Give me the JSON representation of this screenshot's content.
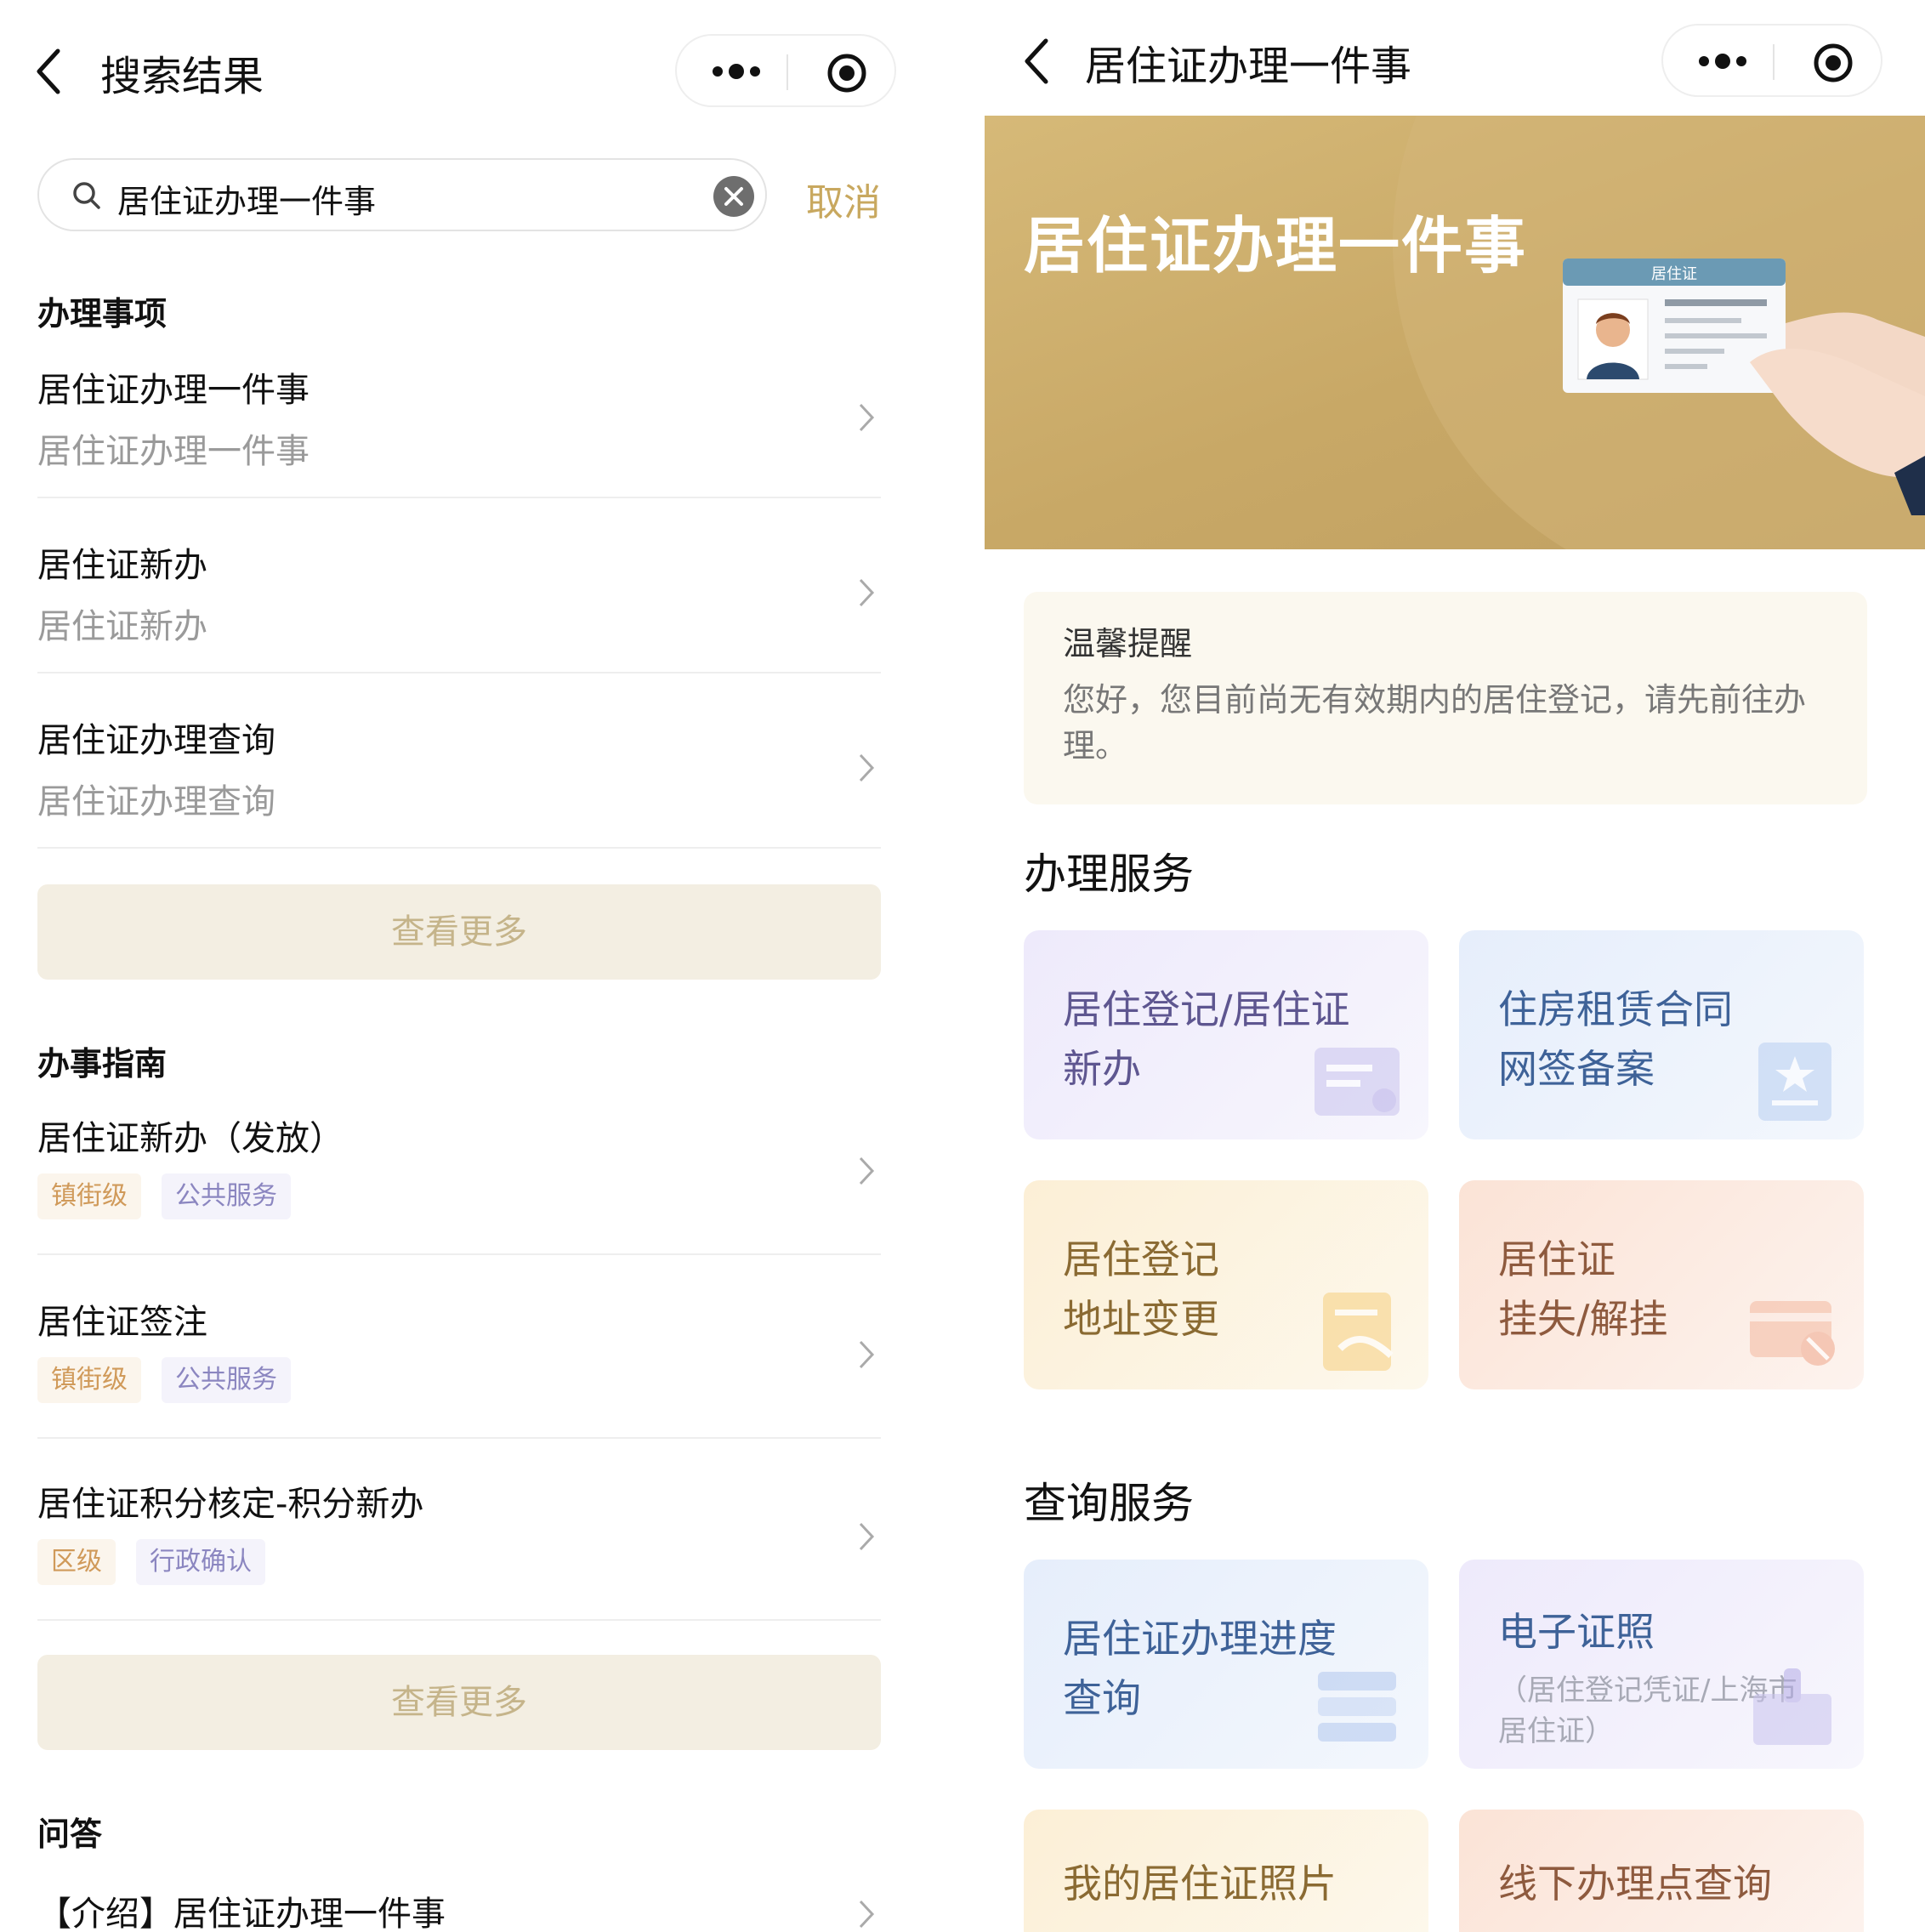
{
  "left": {
    "nav": {
      "title": "搜索结果"
    },
    "search": {
      "value": "居住证办理一件事",
      "cancel_label": "取消"
    },
    "section_items": {
      "title": "办理事项",
      "items": [
        {
          "title": "居住证办理一件事",
          "subtitle": "居住证办理一件事"
        },
        {
          "title": "居住证新办",
          "subtitle": "居住证新办"
        },
        {
          "title": "居住证办理查询",
          "subtitle": "居住证办理查询"
        }
      ],
      "more_label": "查看更多"
    },
    "section_guide": {
      "title": "办事指南",
      "items": [
        {
          "title": "居住证新办（发放）",
          "tags": [
            "镇街级",
            "公共服务"
          ]
        },
        {
          "title": "居住证签注",
          "tags": [
            "镇街级",
            "公共服务"
          ]
        },
        {
          "title": "居住证积分核定-积分新办",
          "tags": [
            "区级",
            "行政确认"
          ]
        }
      ],
      "more_label": "查看更多"
    },
    "section_qa": {
      "title": "问答",
      "items": [
        {
          "title": "【介绍】居住证办理一件事"
        }
      ]
    }
  },
  "right": {
    "nav": {
      "title": "居住证办理一件事"
    },
    "banner": {
      "title": "居住证办理一件事",
      "card_label": "居住证"
    },
    "tip": {
      "title": "温馨提醒",
      "body": "您好，您目前尚无有效期内的居住登记，请先前往办理。"
    },
    "service": {
      "title": "办理服务",
      "cards": [
        {
          "line1": "居住登记/居住证",
          "line2": "新办",
          "icon": "id-card-icon"
        },
        {
          "line1": "住房租赁合同",
          "line2": "网签备案",
          "icon": "star-document-icon"
        },
        {
          "line1": "居住登记",
          "line2": "地址变更",
          "icon": "edit-document-icon"
        },
        {
          "line1": "居住证",
          "line2": "挂失/解挂",
          "icon": "card-block-icon"
        }
      ]
    },
    "query": {
      "title": "查询服务",
      "cards": [
        {
          "line1": "居住证办理进度",
          "line2": "查询",
          "icon": "progress-list-icon"
        },
        {
          "line1": "电子证照",
          "sub1": "（居住登记凭证/上海市",
          "sub2": "居住证）",
          "icon": "stamp-icon"
        },
        {
          "line1": "我的居住证照片",
          "icon": "photo-icon"
        },
        {
          "line1": "线下办理点查询",
          "icon": "location-icon"
        }
      ]
    }
  },
  "colors": {
    "accent_gold": "#c8a85f",
    "more_bg": "#f3eee2",
    "tag_orange": "#d09a5a",
    "tag_purple": "#8b86c0"
  }
}
